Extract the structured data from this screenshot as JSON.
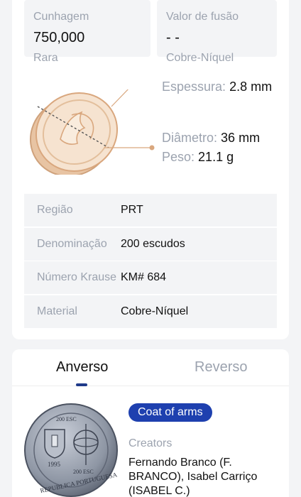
{
  "stats": {
    "mintage_label": "Cunhagem",
    "mintage_value": "750,000",
    "rarity": "Rara",
    "melt_label": "Valor de fusão",
    "melt_value": "- -",
    "melt_material": "Cobre-Níquel"
  },
  "dimensions": {
    "thickness_label": "Espessura:",
    "thickness_value": "2.8 mm",
    "diameter_label": "Diâmetro:",
    "diameter_value": "36 mm",
    "weight_label": "Peso:",
    "weight_value": "21.1 g"
  },
  "attributes": [
    {
      "key": "Região",
      "value": "PRT"
    },
    {
      "key": "Denominação",
      "value": "200 escudos"
    },
    {
      "key": "Número Krause",
      "value": "KM# 684"
    },
    {
      "key": "Material",
      "value": "Cobre-Níquel"
    }
  ],
  "tabs": {
    "obverse": "Anverso",
    "reverse": "Reverso"
  },
  "obverse": {
    "badge": "Coat of arms",
    "creators_label": "Creators",
    "creators_value": "Fernando Branco (F. BRANCO), Isabel Carriço (ISABEL C.)",
    "coin_year": "1995",
    "coin_value": "200 ESC",
    "coin_legend": "REPUBLICA PORTUGUESA"
  },
  "colors": {
    "accent": "#1e40af",
    "muted_text": "#9ca3af",
    "panel_bg": "#f3f4f6",
    "coin_gold": "#d9a77e"
  }
}
